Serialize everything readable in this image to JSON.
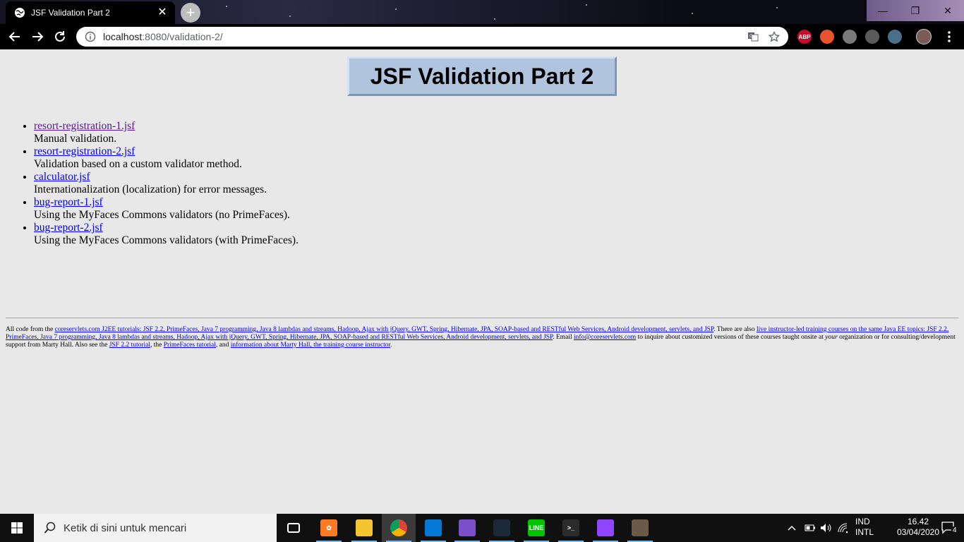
{
  "browser": {
    "tab_title": "JSF Validation Part 2",
    "tab_close": "✕",
    "new_tab": "+",
    "url_host": "localhost",
    "url_path": ":8080/validation-2/",
    "window_min": "—",
    "window_max": "❐",
    "window_close": "✕",
    "extensions": [
      {
        "name": "abp-icon",
        "label": "ABP",
        "color": "#c70d2c"
      },
      {
        "name": "fox-extension-icon",
        "label": "",
        "color": "#e8532d"
      },
      {
        "name": "extension-icon-3",
        "label": "",
        "color": "#7a7a7a"
      },
      {
        "name": "extension-icon-4",
        "label": "",
        "color": "#5a5a5a"
      },
      {
        "name": "extension-icon-5",
        "label": "",
        "color": "#4a6f8a"
      }
    ]
  },
  "page": {
    "title": "JSF Validation Part 2",
    "links": [
      {
        "text": "resort-registration-1.jsf",
        "desc": "Manual validation.",
        "visited": true
      },
      {
        "text": "resort-registration-2.jsf",
        "desc": "Validation based on a custom validator method.",
        "visited": false
      },
      {
        "text": "calculator.jsf",
        "desc": "Internationalization (localization) for error messages.",
        "visited": false
      },
      {
        "text": "bug-report-1.jsf",
        "desc": "Using the MyFaces Commons validators (no PrimeFaces).",
        "visited": false
      },
      {
        "text": "bug-report-2.jsf",
        "desc": "Using the MyFaces Commons validators (with PrimeFaces).",
        "visited": false
      }
    ],
    "footer": {
      "t1": "All code from the ",
      "l1": "coreservlets.com J2EE tutorials: JSF 2.2, PrimeFaces, Java 7 programming, Java 8 lambdas and streams, Hadoop, Ajax with jQuery, GWT, Spring, Hibernate, JPA, SOAP-based and RESTful Web Services, Android development, servlets, and JSP",
      "t2": ". There are also ",
      "l2": "live instructor-led training courses on the same Java EE topics: JSF 2.2, PrimeFaces, Java 7 programming, Java 8 lambdas and streams, Hadoop, Ajax with jQuery, GWT, Spring, Hibernate, JPA, SOAP-based and RESTful Web Services, Android development, servlets, and JSP",
      "t3": ". Email ",
      "l3": "info@coreservlets.com",
      "t4": " to inquire about customized versions of these courses taught onsite at ",
      "t4_em": "your",
      "t5": " organization or for consulting/development support from Marty Hall. Also see the ",
      "l4": "JSF 2.2 tutorial",
      "t6": ", the ",
      "l5": "PrimeFaces tutorial",
      "t7": ", and ",
      "l6": "information about Marty Hall, the training course instructor",
      "t8": "."
    }
  },
  "taskbar": {
    "search_placeholder": "Ketik di sini untuk mencari",
    "apps": [
      {
        "name": "task-view-icon",
        "label": "",
        "color": "#101010"
      },
      {
        "name": "xampp-icon",
        "label": "✿",
        "color": "#fb7a24"
      },
      {
        "name": "file-explorer-icon",
        "label": "",
        "color": "#f4c430"
      },
      {
        "name": "chrome-icon",
        "label": "",
        "color": "#4285f4"
      },
      {
        "name": "vscode-icon",
        "label": "",
        "color": "#0078d4"
      },
      {
        "name": "visual-studio-icon",
        "label": "",
        "color": "#7b4fc9"
      },
      {
        "name": "steam-icon",
        "label": "",
        "color": "#1b2838"
      },
      {
        "name": "line-icon",
        "label": "LINE",
        "color": "#00c300"
      },
      {
        "name": "terminal-icon",
        "label": ">_",
        "color": "#2b2b2b"
      },
      {
        "name": "twitch-icon",
        "label": "",
        "color": "#9146ff"
      },
      {
        "name": "game-icon",
        "label": "",
        "color": "#6b5a45"
      }
    ],
    "lang_line1": "IND",
    "lang_line2": "INTL",
    "time": "16.42",
    "date": "03/04/2020",
    "notifications": "4"
  }
}
